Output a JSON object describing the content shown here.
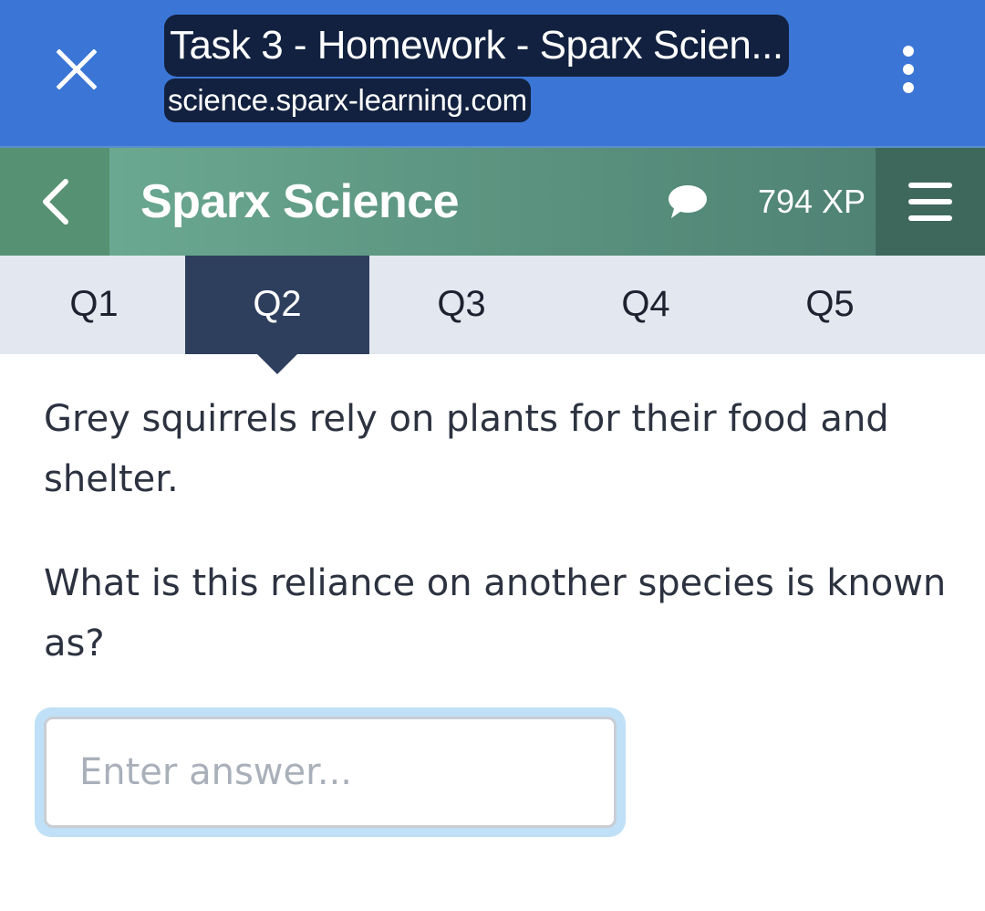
{
  "browser": {
    "page_title": "Task 3 - Homework - Sparx Scien...",
    "url": "science.sparx-learning.com",
    "icons": {
      "close": "close-icon",
      "menu": "more-vert-icon"
    }
  },
  "app_header": {
    "title": "Sparx Science",
    "xp": "794 XP",
    "icons": {
      "back": "chevron-left-icon",
      "chat": "chat-bubble-icon",
      "menu": "hamburger-menu-icon"
    },
    "colors": {
      "header_green": "#5d9682",
      "menu_dark": "#3f685d"
    }
  },
  "tabs": [
    {
      "label": "Q1",
      "active": false
    },
    {
      "label": "Q2",
      "active": true
    },
    {
      "label": "Q3",
      "active": false
    },
    {
      "label": "Q4",
      "active": false
    },
    {
      "label": "Q5",
      "active": false
    }
  ],
  "question": {
    "intro": "Grey squirrels rely on plants for their food and shelter.",
    "prompt": "What is this reliance on another species is known as?"
  },
  "answer": {
    "value": "",
    "placeholder": "Enter answer..."
  },
  "colors": {
    "browser_blue": "#3b76d6",
    "active_tab": "#2e3f5e",
    "tabs_bg": "#e3e8f0",
    "input_focus_ring": "#bfe0f6"
  }
}
